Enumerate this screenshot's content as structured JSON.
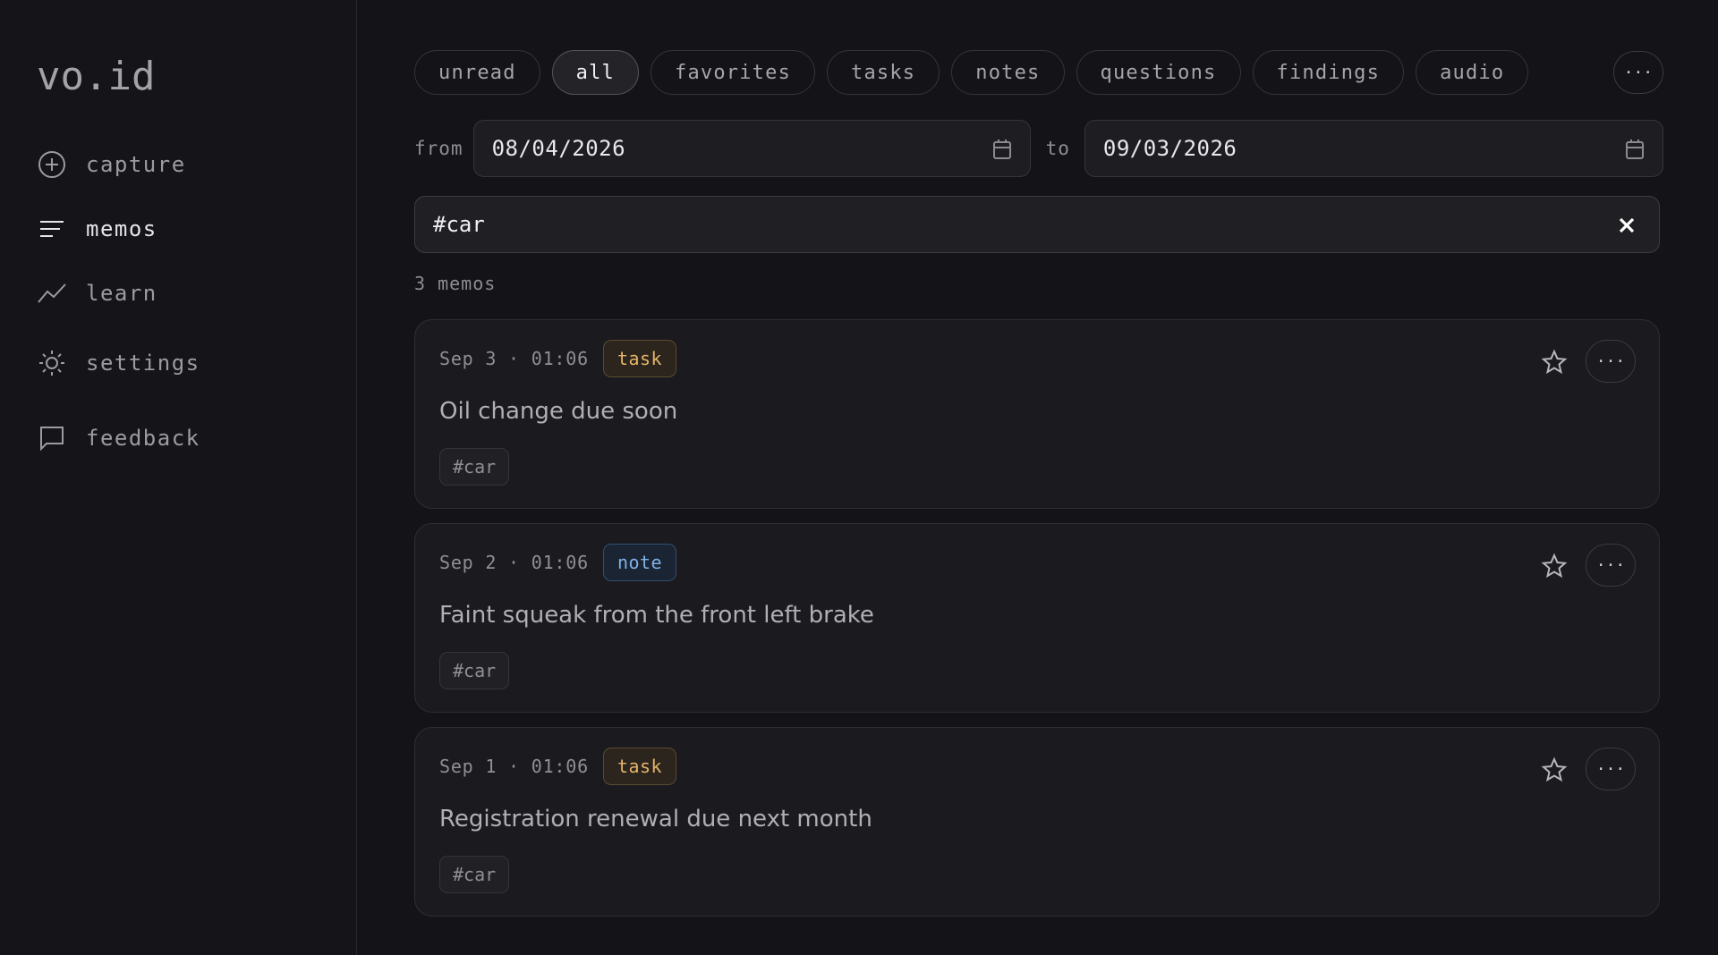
{
  "app": {
    "logo": "vo.id"
  },
  "sidebar": {
    "items": [
      {
        "label": "capture",
        "icon": "plus-circle-icon"
      },
      {
        "label": "memos",
        "icon": "lines-icon",
        "active": true
      },
      {
        "label": "learn",
        "icon": "trend-line-icon"
      },
      {
        "label": "settings",
        "icon": "sun-gear-icon"
      },
      {
        "label": "feedback",
        "icon": "chat-bubble-icon"
      }
    ]
  },
  "filters": {
    "chips": [
      {
        "label": "unread"
      },
      {
        "label": "all",
        "active": true
      },
      {
        "label": "favorites"
      },
      {
        "label": "tasks"
      },
      {
        "label": "notes"
      },
      {
        "label": "questions"
      },
      {
        "label": "findings"
      },
      {
        "label": "audio"
      }
    ],
    "more_label": "···"
  },
  "dates": {
    "from_label": "from",
    "from_value": "08/04/2026",
    "to_label": "to",
    "to_value": "09/03/2026"
  },
  "search": {
    "value": "#car"
  },
  "results": {
    "count_text": "3 memos"
  },
  "memos": [
    {
      "timestamp": "Sep 3 · 01:06",
      "type": "task",
      "title": "Oil change due soon",
      "tag": "#car"
    },
    {
      "timestamp": "Sep 2 · 01:06",
      "type": "note",
      "title": "Faint squeak from the front left brake",
      "tag": "#car"
    },
    {
      "timestamp": "Sep 1 · 01:06",
      "type": "task",
      "title": "Registration renewal due next month",
      "tag": "#car"
    }
  ],
  "colors": {
    "background": "#131318",
    "task_accent": "#e7b46a",
    "note_accent": "#7fb1e9"
  }
}
